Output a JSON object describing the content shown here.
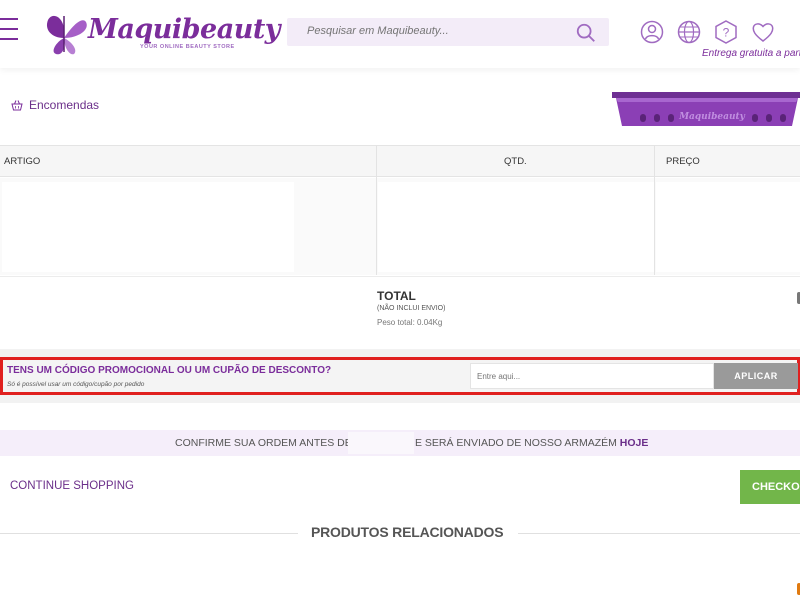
{
  "header": {
    "logo_text": "Maquibeauty",
    "logo_tagline": "YOUR ONLINE BEAUTY STORE",
    "search_placeholder": "Pesquisar em Maquibeauty...",
    "delivery_text": "Entrega gratuita a partir d"
  },
  "orders": {
    "label": "Encomendas",
    "basket_brand": "Maquibeauty"
  },
  "table": {
    "headers": [
      "ARTIGO",
      "QTD.",
      "PREÇO"
    ]
  },
  "total": {
    "title": "TOTAL",
    "note": "(NÃO INCLUI ENVIO)",
    "weight": "Peso total: 0.04Kg"
  },
  "promo": {
    "title": "TENS UM CÓDIGO PROMOCIONAL OU UM CUPÃO DE DESCONTO?",
    "subtitle": "Só é possível usar um código/cupão por pedido",
    "input_placeholder": "Entre aqui...",
    "apply_label": "APLICAR"
  },
  "confirm": {
    "text_before": "CONFIRME SUA ORDEM ANTES DE",
    "text_after": "E SERÁ ENVIADO DE NOSSO ARMAZÉM",
    "text_highlight": "HOJE"
  },
  "actions": {
    "continue_label": "CONTINUE SHOPPING",
    "checkout_label": "CHECKOU"
  },
  "related": {
    "title": "PRODUTOS RELACIONADOS"
  },
  "colors": {
    "brand_purple": "#7b2d9b",
    "checkout_green": "#72b64a",
    "highlight_red": "#e0201f",
    "apply_gray": "#9a9a9a"
  }
}
